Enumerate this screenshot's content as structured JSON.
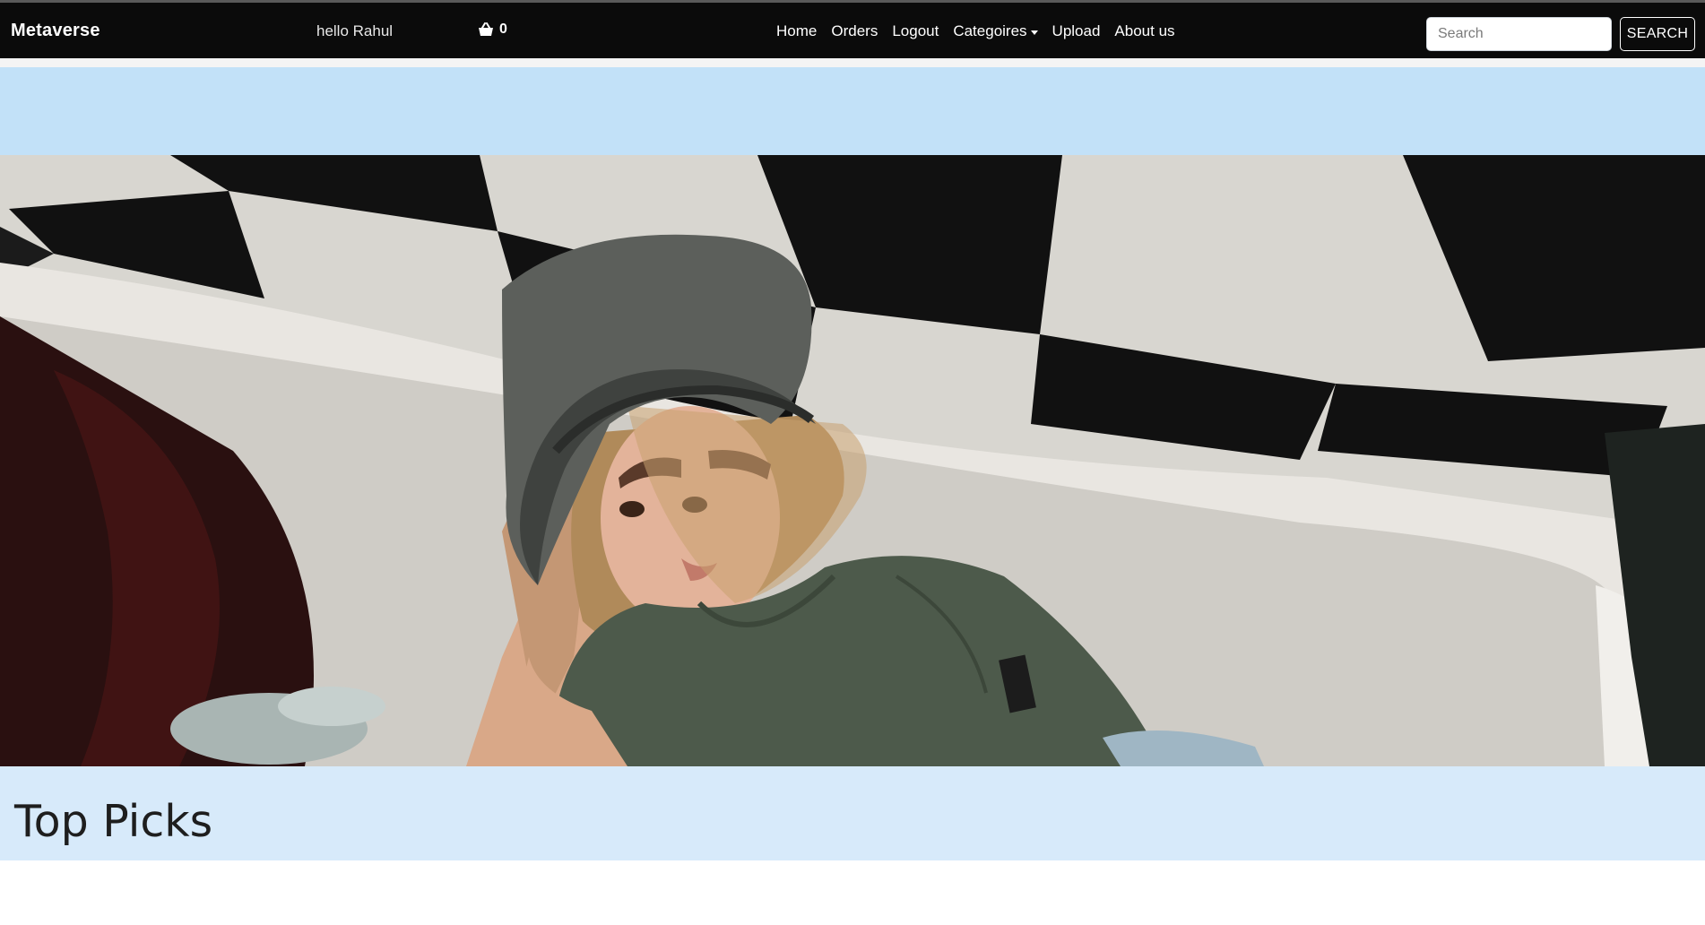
{
  "navbar": {
    "brand": "Metaverse",
    "greeting": "hello Rahul",
    "cart_icon": "shopping-basket-icon",
    "cart_count": "0",
    "links": [
      {
        "label": "Home"
      },
      {
        "label": "Orders"
      },
      {
        "label": "Logout"
      },
      {
        "label": "Categoires",
        "has_dropdown": true
      },
      {
        "label": "Upload"
      },
      {
        "label": "About us"
      }
    ],
    "search": {
      "placeholder": "Search",
      "value": "",
      "button_label": "SEARCH"
    }
  },
  "hero": {
    "image_alt": "Woman in a grey hat and green t-shirt leaning on a white bathtub against a black and white checkered wall"
  },
  "sections": {
    "top_picks_title": "Top Picks"
  },
  "colors": {
    "navbar_bg": "#0b0b0b",
    "hero_band": "#c2e1f8",
    "section_band": "#d7eafa"
  }
}
